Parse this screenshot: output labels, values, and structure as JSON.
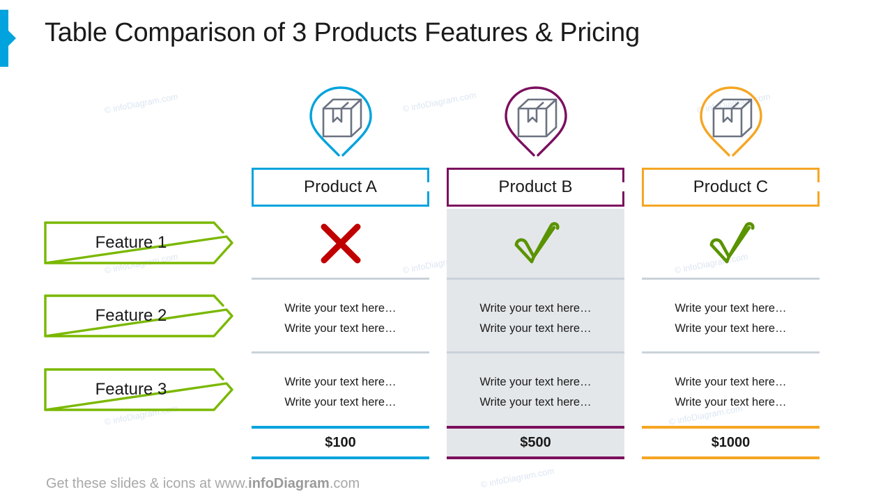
{
  "slide": {
    "title": "Table Comparison of 3 Products Features & Pricing",
    "accent_color": "#00A3DD",
    "background": "#ffffff",
    "highlight_color": "#e4e7ea",
    "separator_color": "#c9d2da",
    "watermark_text": "© infoDiagram.com"
  },
  "products": [
    {
      "name": "Product A",
      "color": "#00A3DD",
      "icon": "package-box-pin-icon",
      "highlighted": false,
      "feature1_status": "cross",
      "feature2_lines": [
        "Write your text here…",
        "Write your text here…"
      ],
      "feature3_lines": [
        "Write your text here…",
        "Write your text here…"
      ],
      "price": "$100"
    },
    {
      "name": "Product B",
      "color": "#7B0F5E",
      "icon": "package-box-pin-icon",
      "highlighted": true,
      "feature1_status": "check",
      "feature2_lines": [
        "Write your text here…",
        "Write your text here…"
      ],
      "feature3_lines": [
        "Write your text here…",
        "Write your text here…"
      ],
      "price": "$500"
    },
    {
      "name": "Product C",
      "color": "#F5A623",
      "icon": "package-box-pin-icon",
      "highlighted": false,
      "feature1_status": "check",
      "feature2_lines": [
        "Write your text here…",
        "Write your text here…"
      ],
      "feature3_lines": [
        "Write your text here…",
        "Write your text here…"
      ],
      "price": "$1000"
    }
  ],
  "features": [
    {
      "label": "Feature 1",
      "color": "#7AB800"
    },
    {
      "label": "Feature 2",
      "color": "#7AB800"
    },
    {
      "label": "Feature 3",
      "color": "#7AB800"
    }
  ],
  "status_icons": {
    "cross_color": "#C00000",
    "check_color": "#5A9300",
    "cross_name": "cross-mark-icon",
    "check_name": "check-mark-icon"
  },
  "footer": {
    "prefix": "Get these slides & icons at www.",
    "brand": "infoDiagram",
    "suffix": ".com"
  }
}
